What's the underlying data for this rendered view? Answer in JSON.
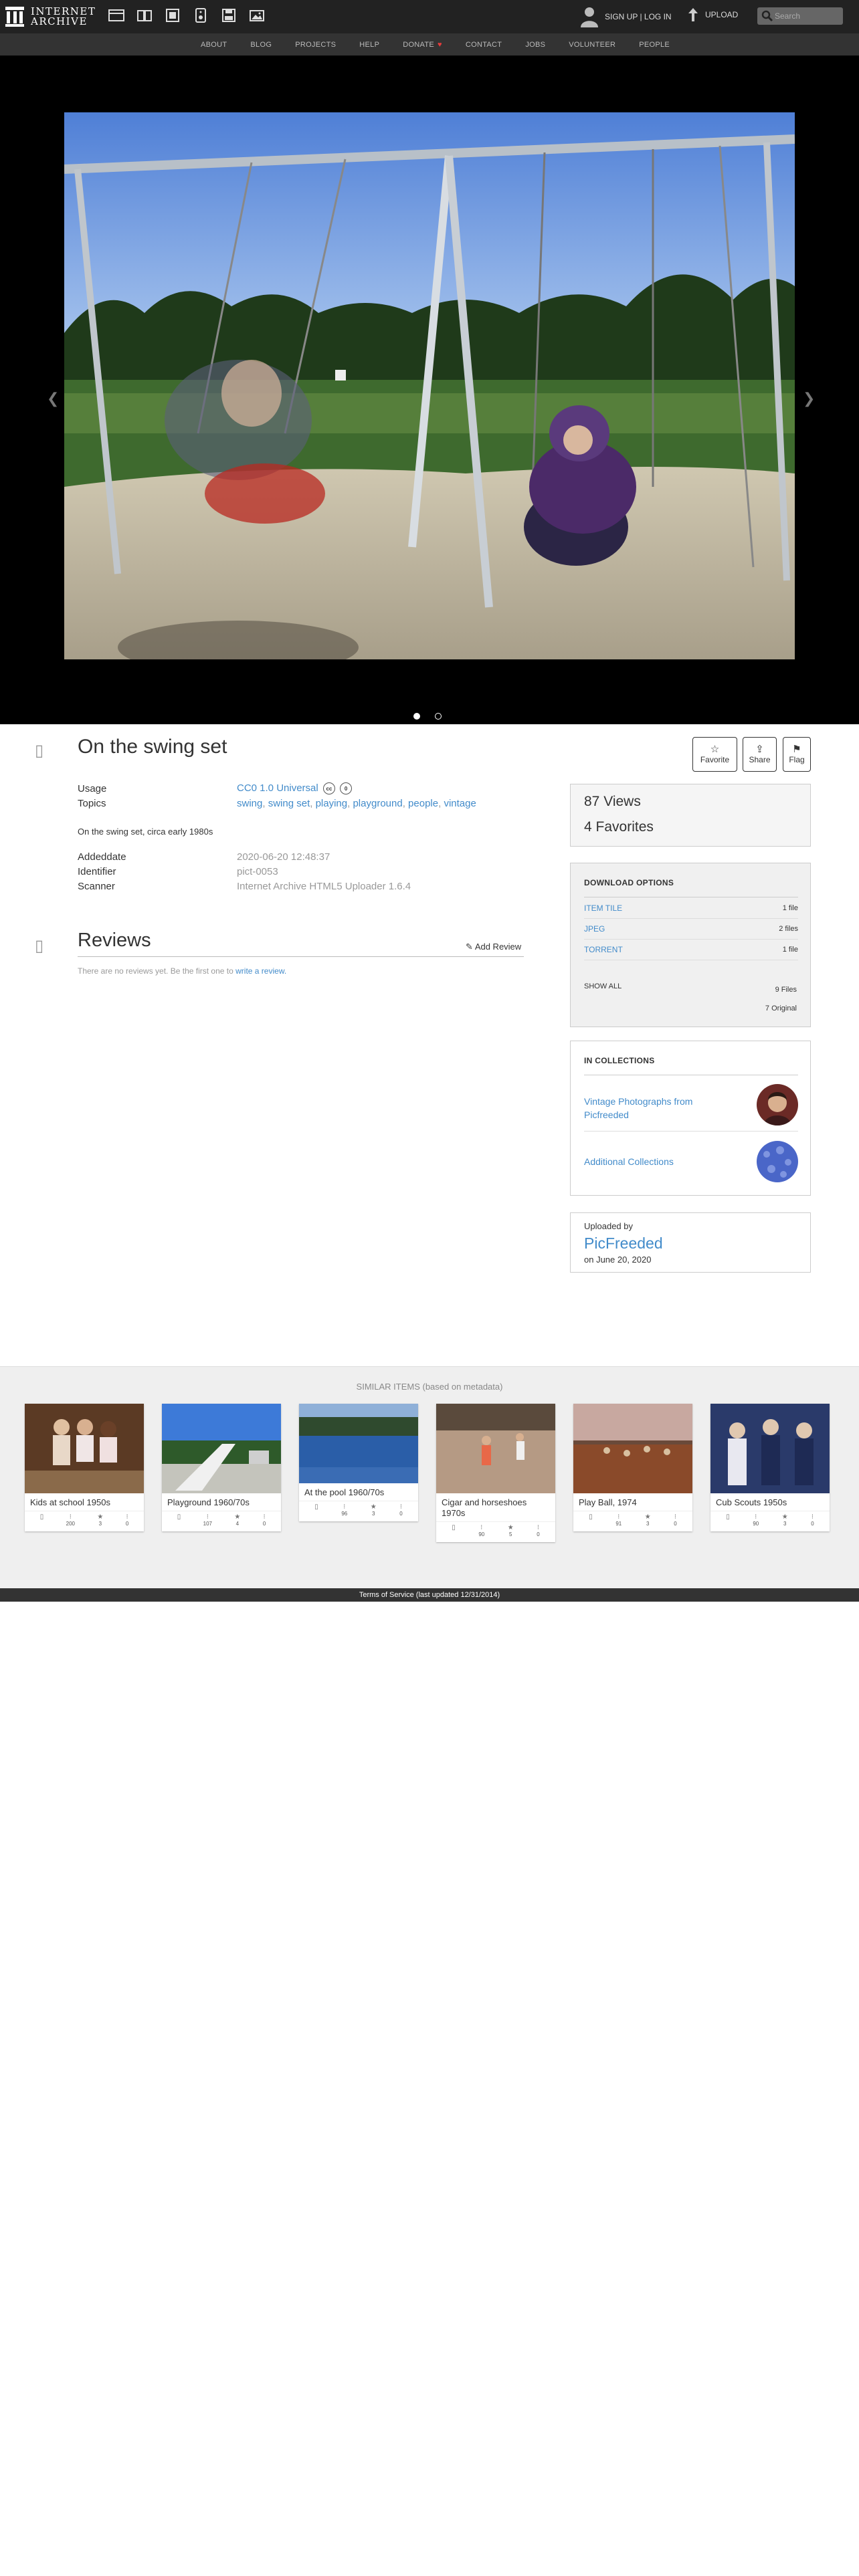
{
  "header": {
    "logo_line1": "INTERNET",
    "logo_line2": "ARCHIVE",
    "media_icons": [
      "web-icon",
      "texts-icon",
      "video-icon",
      "audio-icon",
      "software-icon",
      "images-icon"
    ],
    "signup_label": "SIGN UP | LOG IN",
    "upload_label": "UPLOAD",
    "search_placeholder": "Search"
  },
  "nav": {
    "items": [
      "ABOUT",
      "BLOG",
      "PROJECTS",
      "HELP",
      "DONATE",
      "CONTACT",
      "JOBS",
      "VOLUNTEER",
      "PEOPLE"
    ],
    "donate_heart": "♥"
  },
  "item": {
    "title": "On the swing set",
    "usage_key": "Usage",
    "usage_value": "CC0 1.0 Universal",
    "topics_key": "Topics",
    "topics": [
      "swing",
      "swing set",
      "playing",
      "playground",
      "people",
      "vintage"
    ],
    "description": "On the swing set, circa early 1980s",
    "addeddate_key": "Addeddate",
    "addeddate": "2020-06-20 12:48:37",
    "identifier_key": "Identifier",
    "identifier": "pict-0053",
    "scanner_key": "Scanner",
    "scanner": "Internet Archive HTML5 Uploader 1.6.4"
  },
  "actions": {
    "favorite": "Favorite",
    "share": "Share",
    "flag": "Flag"
  },
  "reviews": {
    "title": "Reviews",
    "add_review": "Add Review",
    "empty_text": "There are no reviews yet. Be the first one to",
    "empty_link": "write a review."
  },
  "stats": {
    "views": "87 Views",
    "favorites": "4 Favorites"
  },
  "downloads": {
    "heading": "DOWNLOAD OPTIONS",
    "rows": [
      {
        "name": "ITEM TILE",
        "count": "1 file"
      },
      {
        "name": "JPEG",
        "count": "2 files"
      },
      {
        "name": "TORRENT",
        "count": "1 file"
      }
    ],
    "show_all": "SHOW ALL",
    "files_count": "9 Files",
    "original_count": "7 Original"
  },
  "collections": {
    "heading": "IN COLLECTIONS",
    "items": [
      "Vintage Photographs from Picfreeded",
      "Additional Collections"
    ]
  },
  "uploader": {
    "label": "Uploaded by",
    "name": "PicFreeded",
    "date": "on June 20, 2020"
  },
  "similar": {
    "title": "SIMILAR ITEMS (based on metadata)",
    "cards": [
      {
        "title": "Kids at school 1950s",
        "views": "200",
        "favs": "3",
        "reviews": "0"
      },
      {
        "title": "Playground 1960/70s",
        "views": "107",
        "favs": "4",
        "reviews": "0"
      },
      {
        "title": "At the pool 1960/70s",
        "views": "96",
        "favs": "3",
        "reviews": "0"
      },
      {
        "title": "Cigar and horseshoes 1970s",
        "views": "90",
        "favs": "5",
        "reviews": "0"
      },
      {
        "title": "Play Ball, 1974",
        "views": "91",
        "favs": "3",
        "reviews": "0"
      },
      {
        "title": "Cub Scouts 1950s",
        "views": "90",
        "favs": "3",
        "reviews": "0"
      }
    ]
  },
  "footer": {
    "text": "Terms of Service (last updated 12/31/2014)"
  },
  "colors": {
    "topbar": "#222222",
    "navbar": "#333333",
    "link": "#428bca",
    "donate_heart": "#e63c3c"
  }
}
